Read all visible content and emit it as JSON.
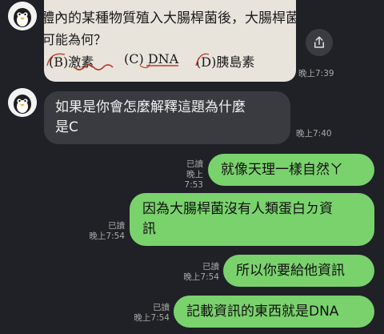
{
  "messages": {
    "image": {
      "line1": "體內的某種物質殖入大腸桿菌後，大腸桿菌",
      "line2": "可能為何？",
      "opt_b": "(B)激素",
      "opt_c": "(C) DNA",
      "opt_d": "(D)胰島素",
      "time": "晚上7:39"
    },
    "incoming": {
      "line1": "如果是你會怎麼解釋這題為什麼",
      "line2": "是C",
      "time": "晚上7:40"
    },
    "out1": {
      "text": "就像天理一樣自然ㄚ",
      "read": "已讀",
      "time": "晚上7:53"
    },
    "out2": {
      "line1": "因為大腸桿菌沒有人類蛋白ㄉ資",
      "line2": "訊",
      "read": "已讀",
      "time": "晚上7:54"
    },
    "out3": {
      "text": "所以你要給他資訊",
      "read": "已讀",
      "time": "晚上7:54"
    },
    "out4": {
      "text": "記載資訊的東西就是DNA",
      "read": "已讀",
      "time": "晚上7:54"
    }
  },
  "colors": {
    "background": "#1f2126",
    "incoming_bubble": "#3a3b40",
    "outgoing_bubble": "#7ad26d"
  },
  "icons": [
    "penguin-avatar",
    "share-icon"
  ]
}
